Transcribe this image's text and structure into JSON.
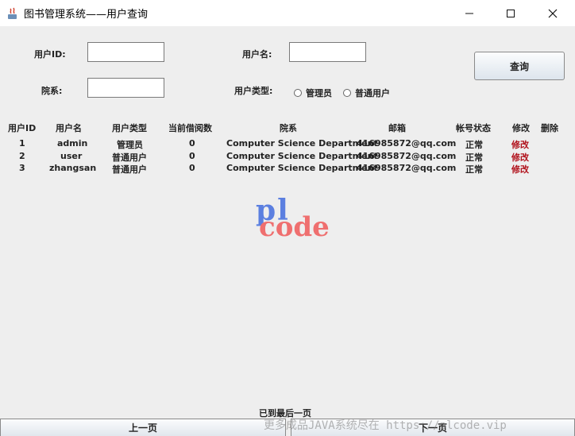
{
  "window": {
    "title": "图书管理系统——用户查询"
  },
  "form": {
    "user_id_label": "用户ID:",
    "username_label": "用户名:",
    "department_label": "院系:",
    "user_type_label": "用户类型:",
    "user_id_value": "",
    "username_value": "",
    "department_value": "",
    "radio_admin": "管理员",
    "radio_normal": "普通用户",
    "query_button": "查询"
  },
  "table": {
    "headers": [
      "用户ID",
      "用户名",
      "用户类型",
      "当前借阅数",
      "院系",
      "邮箱",
      "帐号状态",
      "修改",
      "删除"
    ],
    "rows": [
      {
        "id": "1",
        "username": "admin",
        "type": "管理员",
        "borrowed": "0",
        "department": "Computer Science Department",
        "email": "416985872@qq.com",
        "status": "正常",
        "edit": "修改"
      },
      {
        "id": "2",
        "username": "user",
        "type": "普通用户",
        "borrowed": "0",
        "department": "Computer Science Department",
        "email": "416985872@qq.com",
        "status": "正常",
        "edit": "修改"
      },
      {
        "id": "3",
        "username": "zhangsan",
        "type": "普通用户",
        "borrowed": "0",
        "department": "Computer Science Department",
        "email": "416985872@qq.com",
        "status": "正常",
        "edit": "修改"
      }
    ]
  },
  "logo": {
    "top": "pl",
    "bottom": "code"
  },
  "pagination": {
    "status": "已到最后一页",
    "prev_label": "上一页",
    "next_label": "下一页"
  },
  "watermark": "更多成品JAVA系统尽在 https://plcode.vip",
  "colors": {
    "edit_link": "#b0101a",
    "logo_blue": "#5b7fe0",
    "logo_red": "#ef6f6f"
  }
}
